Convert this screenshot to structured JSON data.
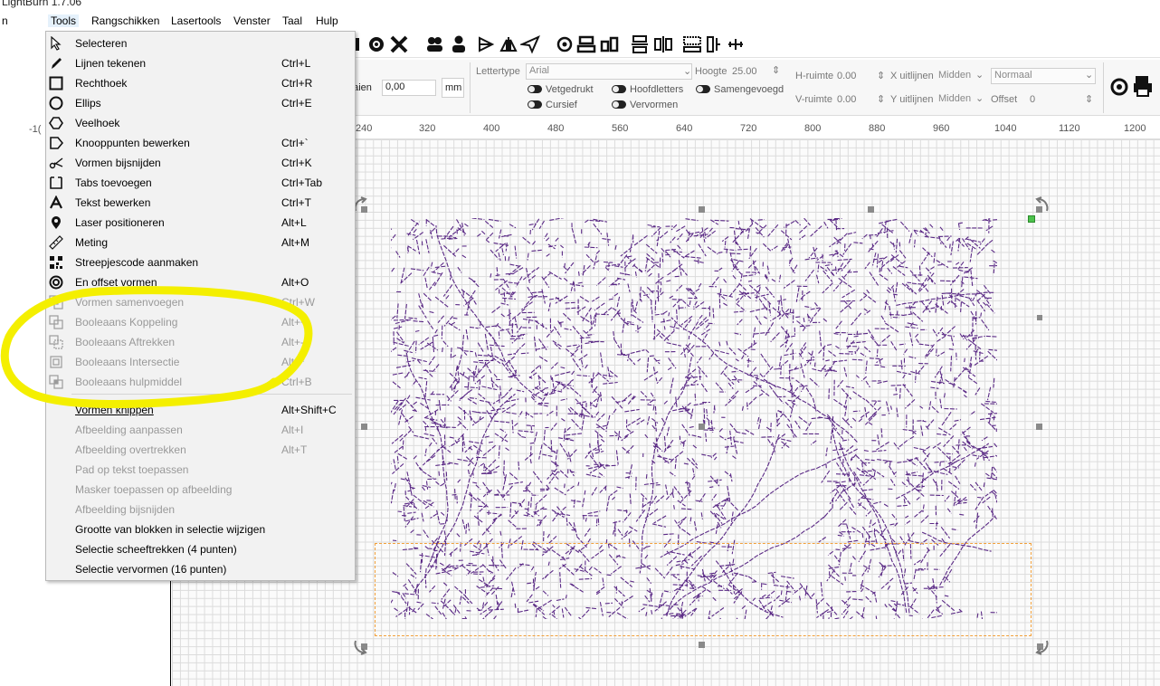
{
  "app": {
    "title": "LightBurn 1.7.06"
  },
  "menubar": [
    "n",
    "Tools",
    "Rangschikken",
    "Lasertools",
    "Venster",
    "Taal",
    "Hulp"
  ],
  "tools_menu": [
    {
      "label": "Selecteren",
      "shortcut": "",
      "icon": "cursor-arrow-icon",
      "enabled": true
    },
    {
      "label": "Lijnen tekenen",
      "shortcut": "Ctrl+L",
      "icon": "pen-icon",
      "enabled": true
    },
    {
      "label": "Rechthoek",
      "shortcut": "Ctrl+R",
      "icon": "rectangle-icon",
      "enabled": true
    },
    {
      "label": "Ellips",
      "shortcut": "Ctrl+E",
      "icon": "ellipse-icon",
      "enabled": true
    },
    {
      "label": "Veelhoek",
      "shortcut": "",
      "icon": "polygon-icon",
      "enabled": true
    },
    {
      "label": "Knooppunten bewerken",
      "shortcut": "Ctrl+`",
      "icon": "edit-nodes-icon",
      "enabled": true
    },
    {
      "label": "Vormen bijsnijden",
      "shortcut": "Ctrl+K",
      "icon": "scissors-icon",
      "enabled": true
    },
    {
      "label": "Tabs toevoegen",
      "shortcut": "Ctrl+Tab",
      "icon": "tabs-icon",
      "enabled": true
    },
    {
      "label": "Tekst bewerken",
      "shortcut": "Ctrl+T",
      "icon": "text-icon",
      "enabled": true
    },
    {
      "label": "Laser positioneren",
      "shortcut": "Alt+L",
      "icon": "location-pin-icon",
      "enabled": true
    },
    {
      "label": "Meting",
      "shortcut": "Alt+M",
      "icon": "ruler-icon",
      "enabled": true
    },
    {
      "label": "Streepjescode aanmaken",
      "shortcut": "",
      "icon": "qr-code-icon",
      "enabled": true
    },
    {
      "label": "En offset vormen",
      "shortcut": "Alt+O",
      "icon": "offset-icon",
      "enabled": true
    },
    {
      "label": "Vormen samenvoegen",
      "shortcut": "Ctrl+W",
      "icon": "weld-icon",
      "enabled": false
    },
    {
      "label": "Booleaans Koppeling",
      "shortcut": "Alt++",
      "icon": "boolean-union-icon",
      "enabled": false
    },
    {
      "label": "Booleaans Aftrekken",
      "shortcut": "Alt+-",
      "icon": "boolean-subtract-icon",
      "enabled": false
    },
    {
      "label": "Booleaans Intersectie",
      "shortcut": "Alt+*",
      "icon": "boolean-intersect-icon",
      "enabled": false
    },
    {
      "label": "Booleaans hulpmiddel",
      "shortcut": "Ctrl+B",
      "icon": "boolean-tool-icon",
      "enabled": false
    },
    {
      "label": "Vormen knippen",
      "shortcut": "Alt+Shift+C",
      "icon": "",
      "enabled": true,
      "hovered": true
    },
    {
      "label": "Afbeelding aanpassen",
      "shortcut": "Alt+I",
      "icon": "",
      "enabled": false
    },
    {
      "label": "Afbeelding overtrekken",
      "shortcut": "Alt+T",
      "icon": "",
      "enabled": false
    },
    {
      "label": "Pad op tekst toepassen",
      "shortcut": "",
      "icon": "",
      "enabled": false
    },
    {
      "label": "Masker toepassen op afbeelding",
      "shortcut": "",
      "icon": "",
      "enabled": false
    },
    {
      "label": "Afbeelding bijsnijden",
      "shortcut": "",
      "icon": "",
      "enabled": false
    },
    {
      "label": "Grootte van blokken in selectie wijzigen",
      "shortcut": "",
      "icon": "",
      "enabled": true
    },
    {
      "label": "Selectie scheeftrekken (4 punten)",
      "shortcut": "",
      "icon": "",
      "enabled": true
    },
    {
      "label": "Selectie vervormen (16 punten)",
      "shortcut": "",
      "icon": "",
      "enabled": true
    }
  ],
  "text_toolbar": {
    "font_label": "Lettertype",
    "font_value": "Arial",
    "height_label": "Hoogte",
    "height_value": "25.00",
    "hspace_label": "H-ruimte",
    "hspace_value": "0.00",
    "vspace_label": "V-ruimte",
    "vspace_value": "0.00",
    "xalign_label": "X uitlijnen",
    "xalign_value": "Midden",
    "yalign_label": "Y uitlijnen",
    "yalign_value": "Midden",
    "style_value": "Normaal",
    "offset_label": "Offset",
    "offset_value": "0",
    "bold_label": "Vetgedrukt",
    "italic_label": "Cursief",
    "caps_label": "Hoofdletters",
    "merged_label": "Samengevoegd",
    "distort_label": "Vervormen",
    "rotate_label": "aaien",
    "rotate_value": "0,00",
    "unit_label": "mm"
  },
  "left_panel": {
    "coord_stub": "-1("
  },
  "ruler": [
    "240",
    "320",
    "400",
    "480",
    "560",
    "640",
    "720",
    "800",
    "880",
    "960",
    "1040",
    "1120",
    "1200"
  ],
  "colors": {
    "map_stroke": "#5b2a86",
    "highlight": "#f4ef00",
    "selection_dash": "#f2a03a",
    "handle_green": "#4cc24c"
  }
}
